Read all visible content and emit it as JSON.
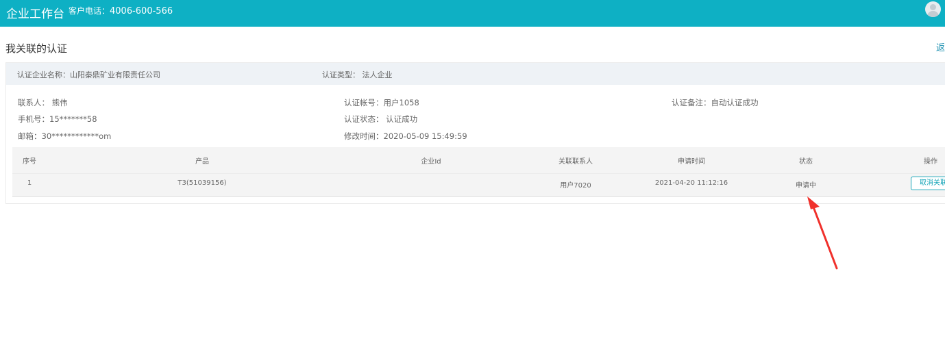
{
  "header": {
    "brand": "企业工作台",
    "phone_label": "客户电话：",
    "phone_number": "4006-600-566"
  },
  "page": {
    "title": "我关联的认证",
    "back_label": "返"
  },
  "cert": {
    "company_name": "认证企业名称：山阳秦鼎矿业有限责任公司",
    "cert_type": "认证类型：  法人企业",
    "contact": "联系人：  熊伟",
    "phone": "手机号：15*******58",
    "email": "邮箱：30************om",
    "account": "认证帐号：用户1058",
    "status": "认证状态：  认证成功",
    "modified": "修改时间：2020-05-09 15:49:59",
    "remark": "认证备注：自动认证成功"
  },
  "table": {
    "headers": {
      "index": "序号",
      "product": "产品",
      "company_id": "企业Id",
      "linked_contact": "关联联系人",
      "apply_time": "申请时间",
      "status": "状态",
      "action": "操作"
    },
    "rows": [
      {
        "index": "1",
        "product": "T3(51039156)",
        "company_id": "",
        "linked_contact": "用户7020",
        "apply_time": "2021-04-20 11:12:16",
        "status": "申请中",
        "action": "取消关联"
      }
    ]
  },
  "colors": {
    "header_bg": "#0eb0c4",
    "accent": "#16a5b8",
    "annotation_arrow": "#f0302b"
  }
}
